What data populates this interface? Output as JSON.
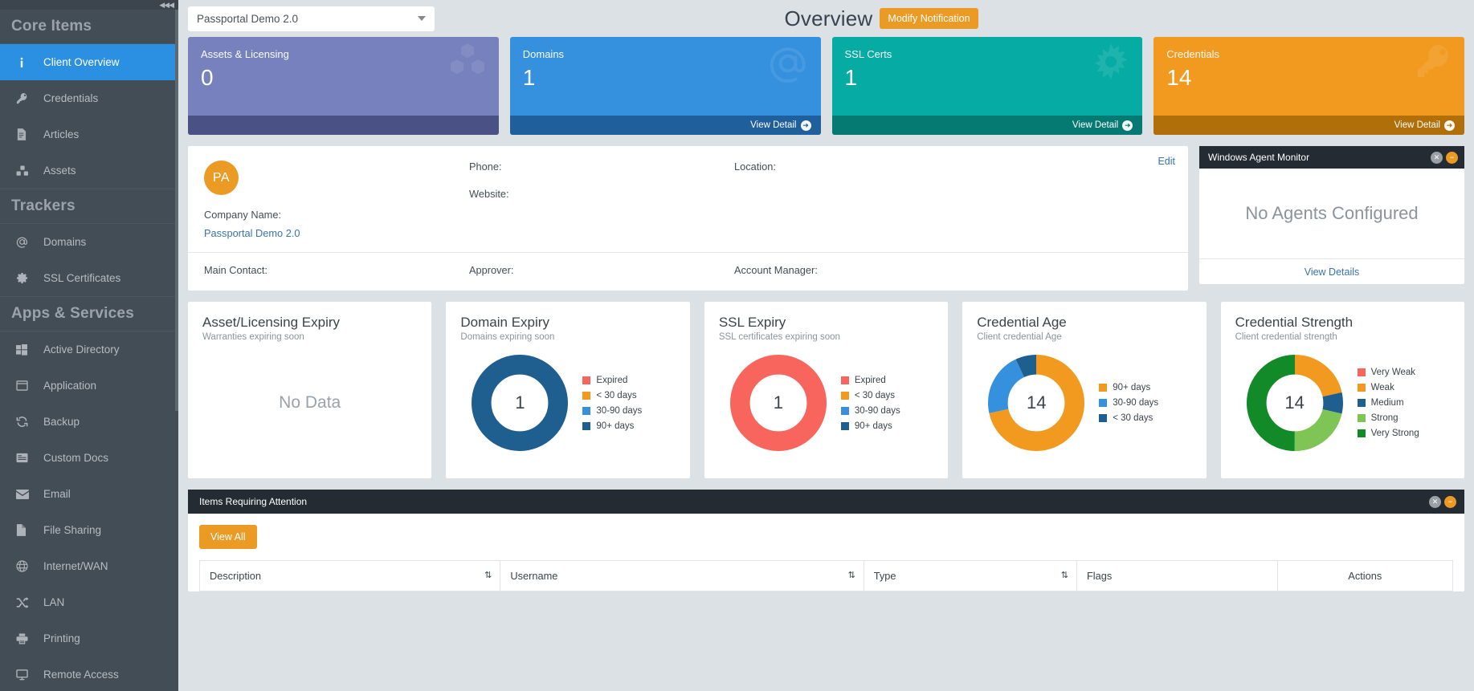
{
  "sidebar": {
    "collapse_icon": "◀◀◀",
    "groups": [
      {
        "title": "Core Items",
        "items": [
          {
            "label": "Client Overview",
            "icon": "info-icon",
            "active": true
          },
          {
            "label": "Credentials",
            "icon": "key-icon",
            "active": false
          },
          {
            "label": "Articles",
            "icon": "article-icon",
            "active": false
          },
          {
            "label": "Assets",
            "icon": "assets-icon",
            "active": false
          }
        ]
      },
      {
        "title": "Trackers",
        "items": [
          {
            "label": "Domains",
            "icon": "at-icon",
            "active": false
          },
          {
            "label": "SSL Certificates",
            "icon": "gear-icon",
            "active": false
          }
        ]
      },
      {
        "title": "Apps & Services",
        "items": [
          {
            "label": "Active Directory",
            "icon": "windows-icon",
            "active": false
          },
          {
            "label": "Application",
            "icon": "window-icon",
            "active": false
          },
          {
            "label": "Backup",
            "icon": "refresh-icon",
            "active": false
          },
          {
            "label": "Custom Docs",
            "icon": "doc-lines-icon",
            "active": false
          },
          {
            "label": "Email",
            "icon": "envelope-icon",
            "active": false
          },
          {
            "label": "File Sharing",
            "icon": "file-icon",
            "active": false
          },
          {
            "label": "Internet/WAN",
            "icon": "globe-icon",
            "active": false
          },
          {
            "label": "LAN",
            "icon": "shuffle-icon",
            "active": false
          },
          {
            "label": "Printing",
            "icon": "printer-icon",
            "active": false
          },
          {
            "label": "Remote Access",
            "icon": "monitor-icon",
            "active": false
          }
        ]
      }
    ]
  },
  "topbar": {
    "client_selected": "Passportal Demo 2.0",
    "page_title": "Overview",
    "modify_notification_label": "Modify Notification"
  },
  "stat_cards": [
    {
      "label": "Assets & Licensing",
      "value": "0",
      "icon": "cubes-icon",
      "bg": "#7781bd",
      "foot_bg": "#4a5185",
      "foot_label": "",
      "has_foot_link": false
    },
    {
      "label": "Domains",
      "value": "1",
      "icon": "at-icon",
      "bg": "#3590dd",
      "foot_bg": "#1f5f9c",
      "foot_label": "View Detail",
      "has_foot_link": true
    },
    {
      "label": "SSL Certs",
      "value": "1",
      "icon": "sun-icon",
      "bg": "#06aba4",
      "foot_bg": "#057a73",
      "foot_label": "View Detail",
      "has_foot_link": true
    },
    {
      "label": "Credentials",
      "value": "14",
      "icon": "key-icon",
      "bg": "#f19a1f",
      "foot_bg": "#b06f08",
      "foot_label": "View Detail",
      "has_foot_link": true
    }
  ],
  "info_panel": {
    "edit_label": "Edit",
    "avatar_initials": "PA",
    "company_name_label": "Company Name:",
    "company_name_value": "Passportal Demo 2.0",
    "phone_label": "Phone:",
    "website_label": "Website:",
    "location_label": "Location:",
    "main_contact_label": "Main Contact:",
    "approver_label": "Approver:",
    "account_manager_label": "Account Manager:"
  },
  "agent_panel": {
    "title": "Windows Agent Monitor",
    "empty_text": "No Agents Configured",
    "view_details_label": "View Details"
  },
  "chart_data": [
    {
      "type": "pie",
      "title": "Asset/Licensing Expiry",
      "subtitle": "Warranties expiring soon",
      "empty_text": "No Data",
      "center_label": "",
      "categories": [],
      "values": [],
      "colors": [],
      "legend_position": "right"
    },
    {
      "type": "pie",
      "title": "Domain Expiry",
      "subtitle": "Domains expiring soon",
      "center_label": "1",
      "categories": [
        "Expired",
        "< 30 days",
        "30-90 days",
        "90+ days"
      ],
      "values": [
        0,
        0,
        0,
        1
      ],
      "colors": [
        "#f8655c",
        "#f19a1f",
        "#3590dd",
        "#1f5f8f"
      ],
      "legend_position": "right"
    },
    {
      "type": "pie",
      "title": "SSL Expiry",
      "subtitle": "SSL certificates expiring soon",
      "center_label": "1",
      "categories": [
        "Expired",
        "< 30 days",
        "30-90 days",
        "90+ days"
      ],
      "values": [
        1,
        0,
        0,
        0
      ],
      "colors": [
        "#f8655c",
        "#f19a1f",
        "#3590dd",
        "#1f5f8f"
      ],
      "legend_position": "right"
    },
    {
      "type": "pie",
      "title": "Credential Age",
      "subtitle": "Client credential Age",
      "center_label": "14",
      "categories": [
        "90+ days",
        "30-90 days",
        "< 30 days"
      ],
      "values": [
        10,
        3,
        1
      ],
      "colors": [
        "#f19a1f",
        "#3590dd",
        "#1f5f8f"
      ],
      "legend_position": "right"
    },
    {
      "type": "pie",
      "title": "Credential Strength",
      "subtitle": "Client credential strength",
      "center_label": "14",
      "categories": [
        "Very Weak",
        "Weak",
        "Medium",
        "Strong",
        "Very Strong"
      ],
      "values": [
        0,
        3,
        1,
        3,
        7
      ],
      "colors": [
        "#f8655c",
        "#f19a1f",
        "#1f5f8f",
        "#7fc556",
        "#128a28"
      ],
      "legend_position": "right"
    }
  ],
  "attention": {
    "title": "Items Requiring Attention",
    "view_all_label": "View All",
    "columns": [
      "Description",
      "Username",
      "Type",
      "Flags",
      "Actions"
    ],
    "rows": []
  }
}
